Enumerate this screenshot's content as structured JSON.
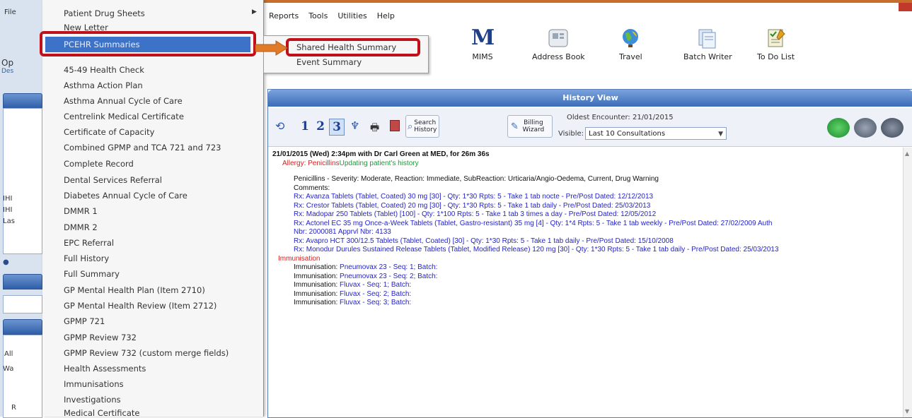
{
  "app": {
    "left_fragments": [
      "File",
      "Op",
      "Des",
      "IHI",
      "IHI",
      "Las",
      "All",
      "Wa",
      "R"
    ]
  },
  "menubar": [
    "Reports",
    "Tools",
    "Utilities",
    "Help"
  ],
  "toolbar": [
    {
      "label": "MIMS",
      "icon": "mims-icon"
    },
    {
      "label": "Address Book",
      "icon": "address-book-icon"
    },
    {
      "label": "Travel",
      "icon": "globe-icon"
    },
    {
      "label": "Batch Writer",
      "icon": "batch-writer-icon"
    },
    {
      "label": "To Do List",
      "icon": "todo-list-icon"
    }
  ],
  "left_menu": {
    "items": [
      "Patient Drug Sheets",
      "New Letter",
      "PCEHR Summaries",
      "45-49 Health Check",
      "Asthma Action Plan",
      "Asthma Annual Cycle of Care",
      "Centrelink Medical Certificate",
      "Certificate of Capacity",
      "Combined GPMP and TCA 721 and 723",
      "Complete Record",
      "Dental Services Referral",
      "Diabetes Annual Cycle of Care",
      "DMMR 1",
      "DMMR 2",
      "EPC Referral",
      "Full History",
      "Full Summary",
      "GP Mental Health Plan (Item 2710)",
      "GP Mental Health Review (Item 2712)",
      "GPMP 721",
      "GPMP Review 732",
      "GPMP Review 732 (custom merge fields)",
      "Health Assessments",
      "Immunisations",
      "Investigations",
      "Medical Certificate"
    ],
    "highlighted_index": 2
  },
  "submenu": {
    "items": [
      "Shared Health Summary",
      "Event Summary"
    ],
    "highlighted_index": 0
  },
  "history_view": {
    "title": "History View",
    "pages": [
      "1",
      "2",
      "3"
    ],
    "selected_page": "3",
    "search_label": "Search History",
    "billing_label": "Billing Wizard",
    "oldest_encounter": "Oldest Encounter: 21/01/2015",
    "visible_label": "Visible:",
    "visible_value": "Last 10 Consultations",
    "header": "21/01/2015 (Wed) 2:34pm with Dr Carl Green at MED, for 26m 36s",
    "allergy_label": "Allergy:",
    "allergy_name": "Penicillins",
    "allergy_status": "Updating patient's history",
    "allergy_detail": "Penicillins - Severity: Moderate, Reaction: Immediate, SubReaction: Urticaria/Angio-Oedema, Current, Drug Warning",
    "comments_label": "Comments:",
    "prescriptions": [
      "Rx: Avanza Tablets (Tablet, Coated) 30 mg [30] - Qty: 1*30 Rpts: 5 - Take 1 tab nocte - Pre/Post Dated: 12/12/2013",
      "Rx: Crestor Tablets (Tablet, Coated) 20 mg [30] - Qty: 1*30 Rpts: 5 - Take 1 tab daily - Pre/Post Dated: 25/03/2013",
      "Rx: Madopar 250 Tablets (Tablet) [100] - Qty: 1*100 Rpts: 5 - Take 1 tab 3 times a day - Pre/Post Dated: 12/05/2012",
      "Rx: Actonel EC 35 mg Once-a-Week Tablets (Tablet, Gastro-resistant) 35 mg [4] - Qty: 1*4 Rpts: 5 - Take 1 tab weekly - Pre/Post Dated: 27/02/2009 Auth",
      "Nbr: 2000081 Apprvl Nbr: 4133",
      "Rx: Avapro HCT 300/12.5 Tablets (Tablet, Coated) [30] - Qty: 1*30 Rpts: 5 - Take 1 tab daily - Pre/Post Dated: 15/10/2008",
      "Rx: Monodur Durules Sustained Release Tablets (Tablet, Modified Release) 120 mg [30] - Qty: 1*30 Rpts: 5 - Take 1 tab daily - Pre/Post Dated: 25/03/2013"
    ],
    "immunisation_heading": "Immunisation",
    "immunisations": [
      {
        "label": "Immunisation:",
        "value": "Pneumovax 23 - Seq: 1; Batch:"
      },
      {
        "label": "Immunisation:",
        "value": "Pneumovax 23 - Seq: 2; Batch:"
      },
      {
        "label": "Immunisation:",
        "value": "Fluvax - Seq: 1; Batch:"
      },
      {
        "label": "Immunisation:",
        "value": "Fluvax - Seq: 2; Batch:"
      },
      {
        "label": "Immunisation:",
        "value": "Fluvax - Seq: 3; Batch:"
      }
    ]
  },
  "colors": {
    "highlight_box": "#c0101a",
    "arrow": "#e07b2a",
    "menu_selection": "#3c73c8",
    "titlebar": "#3b6cb8"
  }
}
